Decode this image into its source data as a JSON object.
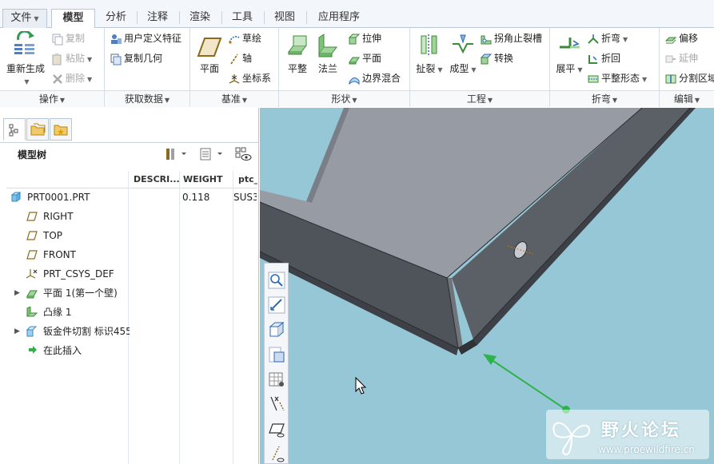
{
  "tabs": {
    "file": "文件",
    "items": [
      "模型",
      "分析",
      "注释",
      "渲染",
      "工具",
      "视图",
      "应用程序"
    ]
  },
  "ribbon": {
    "operations": {
      "label": "操作",
      "regenerate": "重新生成",
      "copy": "复制",
      "paste": "粘贴",
      "delete": "删除"
    },
    "get_data": {
      "label": "获取数据",
      "user_defined_feature": "用户定义特征",
      "copy_geometry": "复制几何"
    },
    "datum": {
      "label": "基准",
      "plane": "平面",
      "sketch": "草绘",
      "axis": "轴",
      "csys": "坐标系"
    },
    "shapes": {
      "label": "形状",
      "flat": "平整",
      "flange": "法兰",
      "extrude": "拉伸",
      "plane": "平面",
      "boundary_blend": "边界混合"
    },
    "engineering": {
      "label": "工程",
      "rip": "扯裂",
      "form": "成型",
      "corner_relief": "拐角止裂槽",
      "convert": "转换"
    },
    "bends": {
      "label": "折弯",
      "unbend": "展平",
      "bend": "折弯",
      "bend_back": "折回",
      "flat_state": "平整形态"
    },
    "editing": {
      "label": "编辑",
      "offset": "偏移",
      "extend": "延伸",
      "split_region": "分割区域"
    }
  },
  "panel": {
    "title": "模型树",
    "columns": [
      "DESCRI...",
      "WEIGHT",
      "ptc_"
    ],
    "rows": [
      {
        "name": "PRT0001.PRT",
        "weight": "0.118",
        "ptc": "SUS3",
        "expandable": false
      },
      {
        "name": "RIGHT",
        "weight": "",
        "ptc": "",
        "expandable": false
      },
      {
        "name": "TOP",
        "weight": "",
        "ptc": "",
        "expandable": false
      },
      {
        "name": "FRONT",
        "weight": "",
        "ptc": "",
        "expandable": false
      },
      {
        "name": "PRT_CSYS_DEF",
        "weight": "",
        "ptc": "",
        "expandable": false
      },
      {
        "name": "平面 1(第一个壁)",
        "weight": "",
        "ptc": "",
        "expandable": true
      },
      {
        "name": "凸缘 1",
        "weight": "",
        "ptc": "",
        "expandable": false
      },
      {
        "name": "钣金件切割 标识455",
        "weight": "",
        "ptc": "",
        "expandable": true
      },
      {
        "name": "在此插入",
        "weight": "",
        "ptc": "",
        "expandable": false
      }
    ]
  },
  "viewport": {
    "background": "#95c7d6",
    "arrow_color": "#2db34a"
  },
  "watermark": {
    "title": "野火论坛",
    "url": "www.proewildfire.cn"
  }
}
